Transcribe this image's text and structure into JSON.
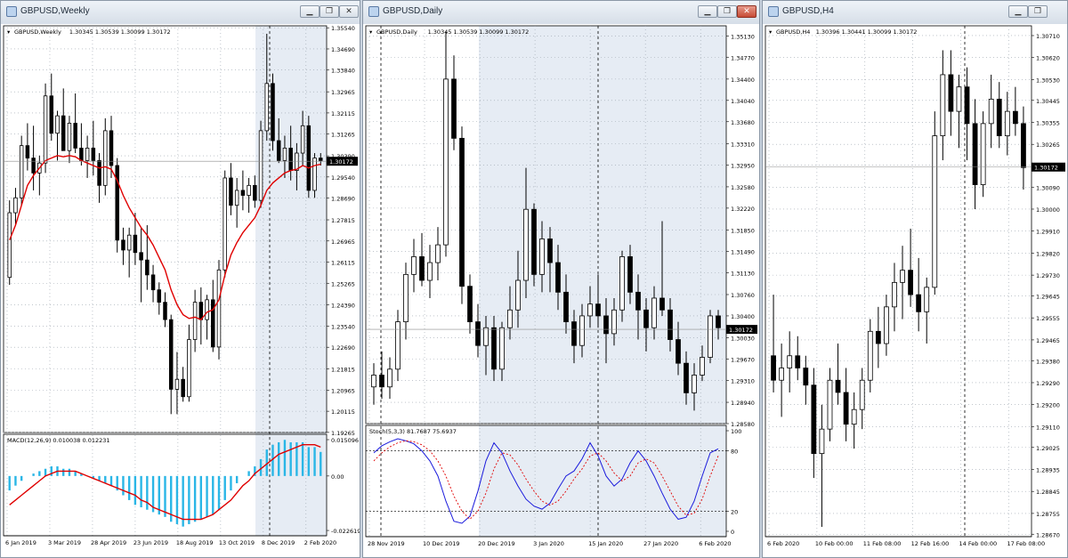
{
  "colors": {
    "bull": "#ffffff",
    "bear": "#000000",
    "ma": "#e00000",
    "macd_hist": "#2ab6e6",
    "stoch_main": "#1a1adc",
    "stoch_signal": "#e00000",
    "highlight": "#e6ecf4",
    "grid": "#9aa3ad"
  },
  "windows": [
    {
      "id": "weekly",
      "title": "GBPUSD,Weekly",
      "buttons": [
        "minimize-icon",
        "restore-icon",
        "close-icon"
      ],
      "symbol_label": "GBPUSD,Weekly",
      "ohlc": "1.30345 1.30539 1.30099 1.30172",
      "price_ticks": [
        "1.35540",
        "1.34690",
        "1.33840",
        "1.32965",
        "1.32115",
        "1.31265",
        "1.30390",
        "1.29540",
        "1.28690",
        "1.27815",
        "1.26965",
        "1.26115",
        "1.25265",
        "1.24390",
        "1.23540",
        "1.22690",
        "1.21815",
        "1.20965",
        "1.20115",
        "1.19265"
      ],
      "price_min": 1.1926,
      "price_max": 1.3562,
      "current_price": "1.30172",
      "indicator_label": "MACD(12,26,9) 0.010038 0.012231",
      "indicator_ticks": [
        "0.015096",
        "0.00",
        "-0.022619"
      ],
      "indicator_min": -0.0226,
      "indicator_max": 0.0151,
      "date_labels": [
        "6 Jan 2019",
        "3 Mar 2019",
        "28 Apr 2019",
        "23 Jun 2019",
        "18 Aug 2019",
        "13 Oct 2019",
        "8 Dec 2019",
        "2 Feb 2020"
      ],
      "candles": [
        [
          1.255,
          1.286,
          1.252,
          1.281
        ],
        [
          1.281,
          1.291,
          1.276,
          1.287
        ],
        [
          1.287,
          1.312,
          1.284,
          1.308
        ],
        [
          1.308,
          1.317,
          1.298,
          1.303
        ],
        [
          1.303,
          1.316,
          1.29,
          1.297
        ],
        [
          1.297,
          1.304,
          1.288,
          1.301
        ],
        [
          1.301,
          1.333,
          1.297,
          1.328
        ],
        [
          1.328,
          1.337,
          1.31,
          1.313
        ],
        [
          1.313,
          1.322,
          1.302,
          1.32
        ],
        [
          1.32,
          1.331,
          1.311,
          1.306
        ],
        [
          1.306,
          1.32,
          1.301,
          1.317
        ],
        [
          1.317,
          1.329,
          1.305,
          1.307
        ],
        [
          1.307,
          1.317,
          1.3,
          1.302
        ],
        [
          1.302,
          1.312,
          1.295,
          1.307
        ],
        [
          1.307,
          1.318,
          1.296,
          1.302
        ],
        [
          1.302,
          1.305,
          1.285,
          1.292
        ],
        [
          1.292,
          1.319,
          1.288,
          1.314
        ],
        [
          1.314,
          1.32,
          1.295,
          1.3
        ],
        [
          1.3,
          1.303,
          1.265,
          1.27
        ],
        [
          1.27,
          1.275,
          1.26,
          1.266
        ],
        [
          1.266,
          1.275,
          1.255,
          1.272
        ],
        [
          1.272,
          1.281,
          1.26,
          1.265
        ],
        [
          1.265,
          1.275,
          1.245,
          1.262
        ],
        [
          1.262,
          1.276,
          1.25,
          1.256
        ],
        [
          1.256,
          1.26,
          1.245,
          1.25
        ],
        [
          1.25,
          1.253,
          1.24,
          1.245
        ],
        [
          1.245,
          1.249,
          1.235,
          1.238
        ],
        [
          1.238,
          1.24,
          1.2,
          1.21
        ],
        [
          1.21,
          1.225,
          1.2,
          1.214
        ],
        [
          1.214,
          1.219,
          1.205,
          1.207
        ],
        [
          1.207,
          1.236,
          1.205,
          1.23
        ],
        [
          1.23,
          1.25,
          1.225,
          1.245
        ],
        [
          1.245,
          1.251,
          1.228,
          1.238
        ],
        [
          1.238,
          1.248,
          1.23,
          1.246
        ],
        [
          1.246,
          1.254,
          1.225,
          1.227
        ],
        [
          1.227,
          1.262,
          1.222,
          1.258
        ],
        [
          1.258,
          1.298,
          1.255,
          1.295
        ],
        [
          1.295,
          1.301,
          1.28,
          1.284
        ],
        [
          1.284,
          1.295,
          1.275,
          1.29
        ],
        [
          1.29,
          1.298,
          1.282,
          1.288
        ],
        [
          1.288,
          1.295,
          1.281,
          1.292
        ],
        [
          1.292,
          1.296,
          1.283,
          1.286
        ],
        [
          1.286,
          1.318,
          1.283,
          1.314
        ],
        [
          1.314,
          1.353,
          1.31,
          1.333
        ],
        [
          1.333,
          1.337,
          1.306,
          1.31
        ],
        [
          1.31,
          1.319,
          1.301,
          1.302
        ],
        [
          1.302,
          1.312,
          1.295,
          1.307
        ],
        [
          1.307,
          1.316,
          1.294,
          1.298
        ],
        [
          1.298,
          1.309,
          1.29,
          1.305
        ],
        [
          1.305,
          1.322,
          1.3,
          1.316
        ],
        [
          1.316,
          1.32,
          1.287,
          1.29
        ],
        [
          1.29,
          1.305,
          1.287,
          1.303
        ],
        [
          1.303,
          1.305,
          1.3,
          1.302
        ]
      ],
      "ma": [
        1.27,
        1.276,
        1.284,
        1.292,
        1.296,
        1.299,
        1.302,
        1.303,
        1.304,
        1.3035,
        1.304,
        1.3035,
        1.302,
        1.301,
        1.3,
        1.299,
        1.2995,
        1.2985,
        1.294,
        1.288,
        1.283,
        1.279,
        1.275,
        1.272,
        1.268,
        1.263,
        1.258,
        1.25,
        1.244,
        1.24,
        1.2385,
        1.239,
        1.238,
        1.241,
        1.242,
        1.246,
        1.256,
        1.264,
        1.269,
        1.273,
        1.276,
        1.279,
        1.284,
        1.29,
        1.293,
        1.295,
        1.297,
        1.298,
        1.2985,
        1.3,
        1.299,
        1.3,
        1.3005
      ],
      "macd": [
        -0.006,
        -0.004,
        -0.002,
        0.0,
        0.001,
        0.002,
        0.003,
        0.004,
        0.004,
        0.003,
        0.003,
        0.002,
        0.001,
        0.0,
        -0.001,
        -0.002,
        -0.003,
        -0.004,
        -0.006,
        -0.008,
        -0.01,
        -0.012,
        -0.013,
        -0.014,
        -0.015,
        -0.016,
        -0.017,
        -0.019,
        -0.02,
        -0.021,
        -0.02,
        -0.019,
        -0.018,
        -0.017,
        -0.016,
        -0.014,
        -0.01,
        -0.006,
        -0.003,
        0.0,
        0.002,
        0.004,
        0.007,
        0.011,
        0.013,
        0.014,
        0.015,
        0.014,
        0.014,
        0.014,
        0.012,
        0.012,
        0.01
      ],
      "macd_signal": [
        -0.012,
        -0.01,
        -0.008,
        -0.006,
        -0.004,
        -0.002,
        0.0,
        0.001,
        0.002,
        0.002,
        0.002,
        0.002,
        0.001,
        0.0,
        -0.001,
        -0.002,
        -0.003,
        -0.004,
        -0.005,
        -0.006,
        -0.007,
        -0.008,
        -0.01,
        -0.011,
        -0.013,
        -0.014,
        -0.015,
        -0.016,
        -0.017,
        -0.018,
        -0.018,
        -0.018,
        -0.018,
        -0.017,
        -0.016,
        -0.014,
        -0.012,
        -0.01,
        -0.007,
        -0.004,
        -0.002,
        0.001,
        0.003,
        0.005,
        0.007,
        0.009,
        0.01,
        0.011,
        0.012,
        0.013,
        0.013,
        0.013,
        0.012
      ]
    },
    {
      "id": "daily",
      "title": "GBPUSD,Daily",
      "buttons": [
        "minimize-icon",
        "restore-icon",
        "close-icon"
      ],
      "symbol_label": "GBPUSD,Daily",
      "ohlc": "1.30345 1.30539 1.30099 1.30172",
      "price_ticks": [
        "1.35130",
        "1.34770",
        "1.34400",
        "1.34040",
        "1.33680",
        "1.33310",
        "1.32950",
        "1.32580",
        "1.32220",
        "1.31850",
        "1.31490",
        "1.31130",
        "1.30760",
        "1.30400",
        "1.30030",
        "1.29670",
        "1.29310",
        "1.28940",
        "1.28580"
      ],
      "price_min": 1.2858,
      "price_max": 1.353,
      "current_price": "1.30172",
      "indicator_label": "Stoch(5,3,3) 81.7687 75.6937",
      "indicator_ticks": [
        "100",
        "80",
        "20",
        "0"
      ],
      "indicator_min": 0,
      "indicator_max": 100,
      "date_labels": [
        "28 Nov 2019",
        "10 Dec 2019",
        "20 Dec 2019",
        "3 Jan 2020",
        "15 Jan 2020",
        "27 Jan 2020",
        "6 Feb 2020"
      ],
      "candles": [
        [
          1.292,
          1.296,
          1.289,
          1.294
        ],
        [
          1.294,
          1.298,
          1.29,
          1.292
        ],
        [
          1.292,
          1.297,
          1.29,
          1.295
        ],
        [
          1.295,
          1.305,
          1.293,
          1.303
        ],
        [
          1.303,
          1.313,
          1.3,
          1.311
        ],
        [
          1.311,
          1.317,
          1.308,
          1.314
        ],
        [
          1.314,
          1.318,
          1.309,
          1.31
        ],
        [
          1.31,
          1.316,
          1.307,
          1.313
        ],
        [
          1.313,
          1.319,
          1.31,
          1.316
        ],
        [
          1.316,
          1.352,
          1.314,
          1.344
        ],
        [
          1.344,
          1.348,
          1.332,
          1.334
        ],
        [
          1.334,
          1.336,
          1.306,
          1.309
        ],
        [
          1.309,
          1.311,
          1.301,
          1.303
        ],
        [
          1.303,
          1.306,
          1.297,
          1.299
        ],
        [
          1.299,
          1.304,
          1.294,
          1.302
        ],
        [
          1.302,
          1.304,
          1.293,
          1.295
        ],
        [
          1.295,
          1.303,
          1.293,
          1.302
        ],
        [
          1.302,
          1.309,
          1.3,
          1.305
        ],
        [
          1.305,
          1.315,
          1.302,
          1.31
        ],
        [
          1.31,
          1.329,
          1.307,
          1.322
        ],
        [
          1.322,
          1.323,
          1.309,
          1.311
        ],
        [
          1.311,
          1.32,
          1.308,
          1.317
        ],
        [
          1.317,
          1.319,
          1.308,
          1.313
        ],
        [
          1.313,
          1.316,
          1.305,
          1.308
        ],
        [
          1.308,
          1.311,
          1.301,
          1.303
        ],
        [
          1.303,
          1.305,
          1.296,
          1.299
        ],
        [
          1.299,
          1.306,
          1.297,
          1.304
        ],
        [
          1.304,
          1.309,
          1.302,
          1.306
        ],
        [
          1.306,
          1.311,
          1.302,
          1.304
        ],
        [
          1.304,
          1.307,
          1.296,
          1.301
        ],
        [
          1.301,
          1.307,
          1.299,
          1.305
        ],
        [
          1.305,
          1.315,
          1.303,
          1.314
        ],
        [
          1.314,
          1.316,
          1.306,
          1.308
        ],
        [
          1.308,
          1.311,
          1.3,
          1.305
        ],
        [
          1.305,
          1.307,
          1.298,
          1.302
        ],
        [
          1.302,
          1.309,
          1.3,
          1.307
        ],
        [
          1.307,
          1.32,
          1.304,
          1.305
        ],
        [
          1.305,
          1.307,
          1.298,
          1.3
        ],
        [
          1.3,
          1.303,
          1.294,
          1.296
        ],
        [
          1.296,
          1.298,
          1.289,
          1.291
        ],
        [
          1.291,
          1.296,
          1.288,
          1.294
        ],
        [
          1.294,
          1.299,
          1.293,
          1.297
        ],
        [
          1.297,
          1.305,
          1.296,
          1.304
        ],
        [
          1.304,
          1.305,
          1.3,
          1.302
        ]
      ],
      "stoch": [
        78,
        85,
        89,
        92,
        90,
        87,
        80,
        70,
        55,
        30,
        10,
        8,
        15,
        40,
        70,
        88,
        78,
        60,
        45,
        32,
        25,
        22,
        28,
        42,
        55,
        60,
        72,
        88,
        75,
        55,
        45,
        52,
        68,
        80,
        70,
        55,
        38,
        22,
        12,
        14,
        30,
        55,
        78,
        82
      ],
      "stoch_signal": [
        70,
        78,
        84,
        88,
        90,
        89,
        86,
        80,
        70,
        55,
        35,
        20,
        12,
        20,
        38,
        62,
        78,
        76,
        66,
        52,
        40,
        30,
        26,
        30,
        40,
        52,
        62,
        75,
        78,
        70,
        58,
        50,
        55,
        68,
        72,
        68,
        55,
        40,
        25,
        16,
        18,
        32,
        55,
        75
      ]
    },
    {
      "id": "h4",
      "title": "GBPUSD,H4",
      "buttons": [
        "minimize-icon",
        "restore-icon"
      ],
      "symbol_label": "GBPUSD,H4",
      "ohlc": "1.30396 1.30441 1.30099 1.30172",
      "price_ticks": [
        "1.30710",
        "1.30620",
        "1.30530",
        "1.30445",
        "1.30355",
        "1.30265",
        "1.30180",
        "1.30090",
        "1.30000",
        "1.29910",
        "1.29820",
        "1.29730",
        "1.29645",
        "1.29555",
        "1.29465",
        "1.29380",
        "1.29290",
        "1.29200",
        "1.29110",
        "1.29025",
        "1.28935",
        "1.28845",
        "1.28755",
        "1.28670"
      ],
      "price_min": 1.2866,
      "price_max": 1.3075,
      "current_price": "1.30172",
      "date_labels": [
        "6 Feb 2020",
        "10 Feb 00:00",
        "11 Feb 08:00",
        "12 Feb 16:00",
        "14 Feb 00:00",
        "17 Feb 08:00"
      ],
      "candles": [
        [
          1.294,
          1.2965,
          1.2925,
          1.293
        ],
        [
          1.293,
          1.2945,
          1.2915,
          1.2935
        ],
        [
          1.2935,
          1.295,
          1.2925,
          1.294
        ],
        [
          1.294,
          1.2948,
          1.293,
          1.2935
        ],
        [
          1.2935,
          1.294,
          1.292,
          1.2928
        ],
        [
          1.2928,
          1.2935,
          1.289,
          1.29
        ],
        [
          1.29,
          1.292,
          1.287,
          1.291
        ],
        [
          1.291,
          1.2935,
          1.2905,
          1.293
        ],
        [
          1.293,
          1.2945,
          1.292,
          1.2925
        ],
        [
          1.2925,
          1.2935,
          1.2905,
          1.2912
        ],
        [
          1.2912,
          1.2925,
          1.2902,
          1.2918
        ],
        [
          1.2918,
          1.2935,
          1.291,
          1.293
        ],
        [
          1.293,
          1.2955,
          1.2925,
          1.295
        ],
        [
          1.295,
          1.296,
          1.2935,
          1.2945
        ],
        [
          1.2945,
          1.2965,
          1.294,
          1.296
        ],
        [
          1.296,
          1.2978,
          1.295,
          1.297
        ],
        [
          1.297,
          1.2985,
          1.2955,
          1.2975
        ],
        [
          1.2975,
          1.2992,
          1.296,
          1.2965
        ],
        [
          1.2965,
          1.298,
          1.295,
          1.2958
        ],
        [
          1.2958,
          1.2972,
          1.2945,
          1.2968
        ],
        [
          1.2968,
          1.304,
          1.2965,
          1.303
        ],
        [
          1.303,
          1.3065,
          1.302,
          1.3055
        ],
        [
          1.3055,
          1.3065,
          1.303,
          1.304
        ],
        [
          1.304,
          1.3055,
          1.3025,
          1.305
        ],
        [
          1.305,
          1.3058,
          1.302,
          1.3035
        ],
        [
          1.3035,
          1.3045,
          1.3,
          1.301
        ],
        [
          1.301,
          1.304,
          1.3005,
          1.3035
        ],
        [
          1.3035,
          1.3055,
          1.3025,
          1.3045
        ],
        [
          1.3045,
          1.3052,
          1.3025,
          1.303
        ],
        [
          1.303,
          1.3048,
          1.3022,
          1.304
        ],
        [
          1.304,
          1.305,
          1.303,
          1.3035
        ],
        [
          1.3035,
          1.3042,
          1.3008,
          1.3017
        ]
      ]
    }
  ]
}
